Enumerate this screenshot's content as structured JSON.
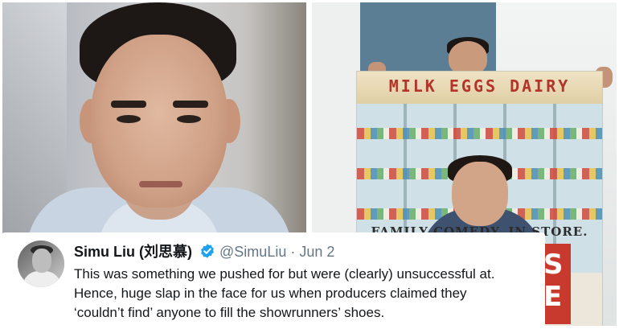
{
  "left_photo": {
    "icon": "man-portrait-photo"
  },
  "right_photo": {
    "icon": "poster-photo",
    "poster_sign": "MILK EGGS DAIRY",
    "poster_tagline": "FAMILY COMEDY. IN STORE.",
    "poster_side_letters": "S E"
  },
  "tweet": {
    "display_name": "Simu Liu (刘思慕)",
    "verified_icon": "verified-badge-icon",
    "handle": "@SimuLiu",
    "separator": "·",
    "date": "Jun 2",
    "lines": [
      "This was something we pushed for but were (clearly) unsuccessful at.",
      "Hence, huge slap in the face for us when producers claimed they",
      "‘couldn’t find’ anyone to fill the showrunners’ shoes."
    ]
  },
  "colors": {
    "verified": "#1da1f2",
    "text": "#14171a",
    "muted": "#657786",
    "sign_red": "#b3342a"
  }
}
